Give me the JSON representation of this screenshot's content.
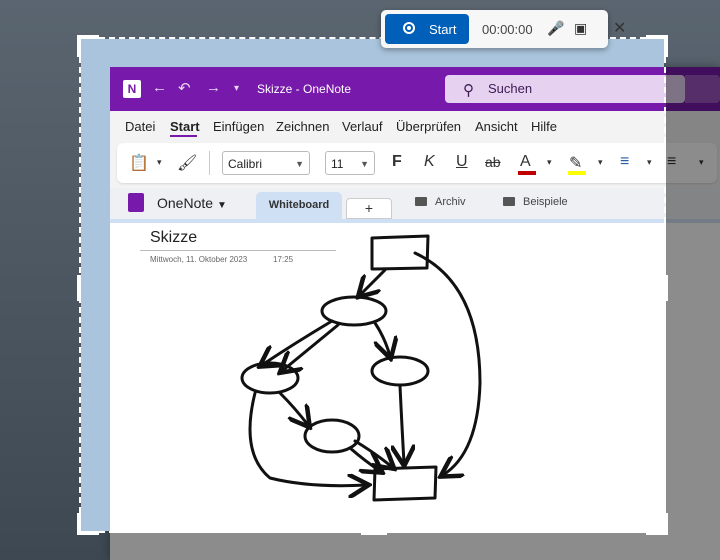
{
  "recorder": {
    "start_label": "Start",
    "timer": "00:00:00"
  },
  "titlebar": {
    "title": "Skizze  -  OneNote",
    "search_placeholder": "Suchen"
  },
  "menu": [
    "Datei",
    "Start",
    "Einfügen",
    "Zeichnen",
    "Verlauf",
    "Überprüfen",
    "Ansicht",
    "Hilfe"
  ],
  "ribbon": {
    "font_family": "Calibri",
    "font_size": "11",
    "bold": "F",
    "italic": "K",
    "underline": "U",
    "strike": "ab",
    "font_color": "A"
  },
  "navbar": {
    "notebook": "OneNote",
    "tabs": [
      "Whiteboard",
      "+",
      "Archiv",
      "Beispiele"
    ]
  },
  "page": {
    "title": "Skizze",
    "date": "Mittwoch, 11. Oktober 2023",
    "time": "17:25"
  },
  "colors": {
    "brand": "#7719aa",
    "record": "#005fb8",
    "font_color_bar": "#c00000",
    "highlight_bar": "#ffff00"
  }
}
